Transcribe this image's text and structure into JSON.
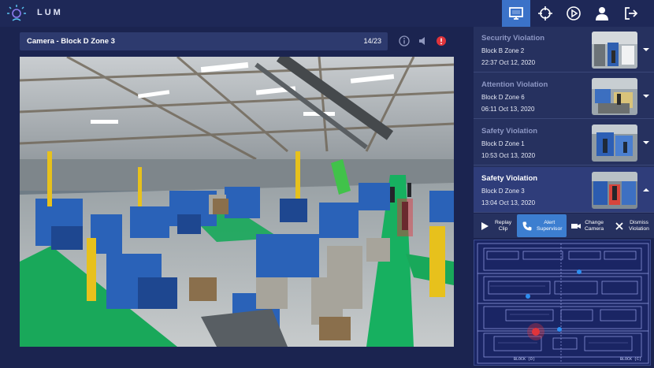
{
  "app": {
    "name": "LUM"
  },
  "nav": {
    "items": [
      {
        "name": "monitor",
        "icon": "monitor-icon",
        "active": true
      },
      {
        "name": "target",
        "icon": "crosshair-icon",
        "active": false
      },
      {
        "name": "play",
        "icon": "play-circle-icon",
        "active": false
      },
      {
        "name": "user",
        "icon": "user-icon",
        "active": false
      },
      {
        "name": "logout",
        "icon": "logout-icon",
        "active": false
      }
    ]
  },
  "camera": {
    "title": "Camera - Block D Zone 3",
    "counter": "14/23",
    "controls": [
      "info-icon",
      "speaker-icon",
      "alert-icon"
    ]
  },
  "violations": [
    {
      "title": "Security Violation",
      "location": "Block B Zone 2",
      "time": "22:37 Oct 12, 2020",
      "selected": false
    },
    {
      "title": "Attention Violation",
      "location": "Block D Zone 6",
      "time": "06:11 Oct 13, 2020",
      "selected": false
    },
    {
      "title": "Safety Violation",
      "location": "Block D Zone 1",
      "time": "10:53 Oct 13, 2020",
      "selected": false
    },
    {
      "title": "Safety Violation",
      "location": "Block D Zone 3",
      "time": "13:04 Oct 13, 2020",
      "selected": true
    }
  ],
  "actions": {
    "replay": "Replay\nClip",
    "alert": "Alert\nSupervisor",
    "change": "Change\nCamera",
    "dismiss": "Dismiss\nViolation"
  },
  "map": {
    "labels": {
      "block_d": "BLOCK (D)",
      "block_c": "BLOCK (C)"
    }
  },
  "colors": {
    "accent": "#3c7ed0",
    "alert": "#e0343b",
    "background": "#1b2450"
  }
}
